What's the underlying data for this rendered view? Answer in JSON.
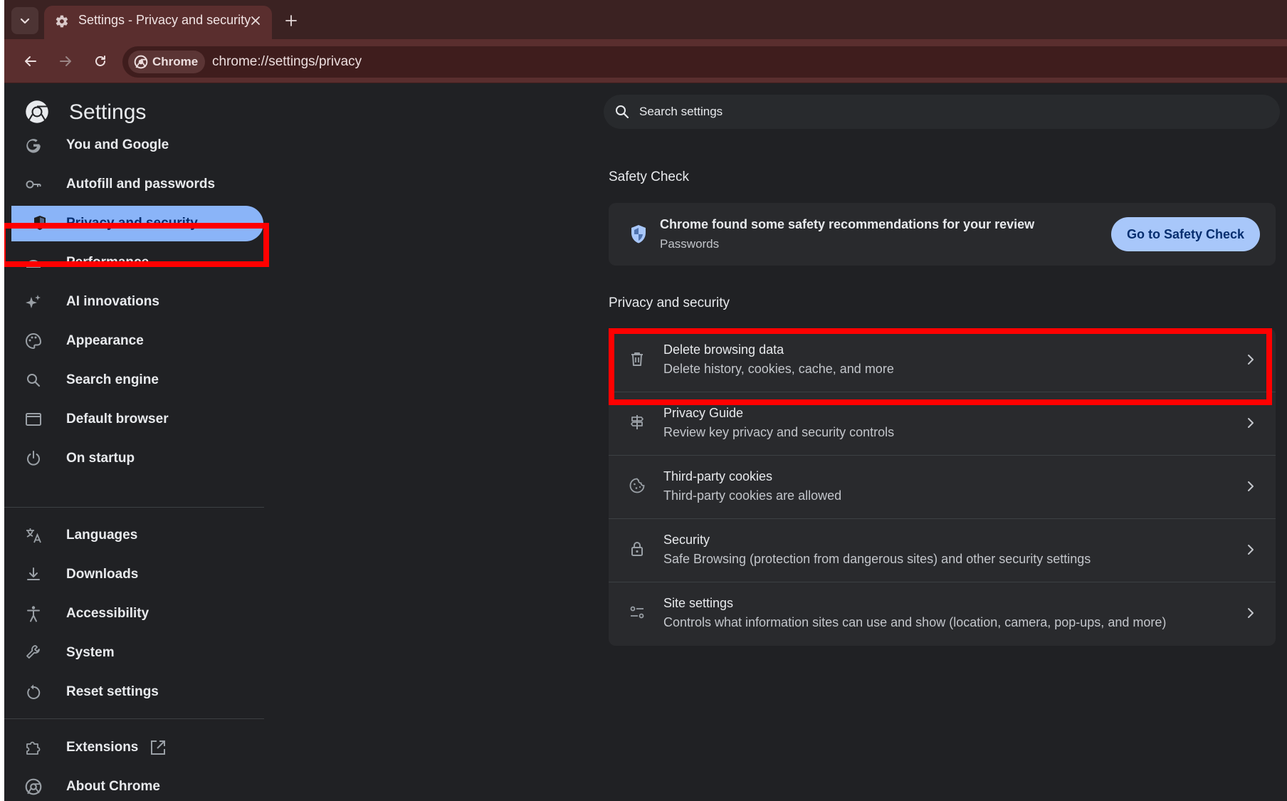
{
  "browser": {
    "tab_title": "Settings - Privacy and security",
    "chip_label": "Chrome",
    "url": "chrome://settings/privacy",
    "icons": {
      "tab_menu": "chevron-down-icon",
      "tab_favicon": "gear-icon",
      "tab_close": "close-icon",
      "new_tab": "plus-icon",
      "back": "arrow-left-icon",
      "forward": "arrow-right-icon",
      "reload": "reload-icon"
    }
  },
  "sidebar": {
    "title": "Settings",
    "items": [
      {
        "label": "You and Google",
        "icon": "google-icon"
      },
      {
        "label": "Autofill and passwords",
        "icon": "key-icon"
      },
      {
        "label": "Privacy and security",
        "icon": "shield-icon",
        "selected": true
      },
      {
        "label": "Performance",
        "icon": "speedometer-icon"
      },
      {
        "label": "AI innovations",
        "icon": "sparkle-icon"
      },
      {
        "label": "Appearance",
        "icon": "palette-icon"
      },
      {
        "label": "Search engine",
        "icon": "search-icon"
      },
      {
        "label": "Default browser",
        "icon": "browser-window-icon"
      },
      {
        "label": "On startup",
        "icon": "power-icon"
      },
      {
        "label": "Languages",
        "icon": "translate-icon"
      },
      {
        "label": "Downloads",
        "icon": "download-icon"
      },
      {
        "label": "Accessibility",
        "icon": "accessibility-icon"
      },
      {
        "label": "System",
        "icon": "wrench-icon"
      },
      {
        "label": "Reset settings",
        "icon": "reset-icon"
      },
      {
        "label": "Extensions",
        "icon": "puzzle-icon"
      },
      {
        "label": "About Chrome",
        "icon": "chrome-icon"
      }
    ]
  },
  "search": {
    "placeholder": "Search settings"
  },
  "safety_check": {
    "section_title": "Safety Check",
    "title": "Chrome found some safety recommendations for your review",
    "subtitle": "Passwords",
    "button": "Go to Safety Check"
  },
  "privacy": {
    "section_title": "Privacy and security",
    "rows": [
      {
        "title": "Delete browsing data",
        "subtitle": "Delete history, cookies, cache, and more",
        "icon": "trash-icon"
      },
      {
        "title": "Privacy Guide",
        "subtitle": "Review key privacy and security controls",
        "icon": "signpost-icon"
      },
      {
        "title": "Third-party cookies",
        "subtitle": "Third-party cookies are allowed",
        "icon": "cookie-icon"
      },
      {
        "title": "Security",
        "subtitle": "Safe Browsing (protection from dangerous sites) and other security settings",
        "icon": "lock-icon"
      },
      {
        "title": "Site settings",
        "subtitle": "Controls what information sites can use and show (location, camera, pop-ups, and more)",
        "icon": "sliders-icon"
      }
    ]
  },
  "colors": {
    "highlight": "#ff0000",
    "accent": "#8ab4f8",
    "button_bg": "#a8c7fa",
    "tab_strip": "#3b2222",
    "toolbar": "#5a2e2e",
    "page_bg": "#202124"
  }
}
